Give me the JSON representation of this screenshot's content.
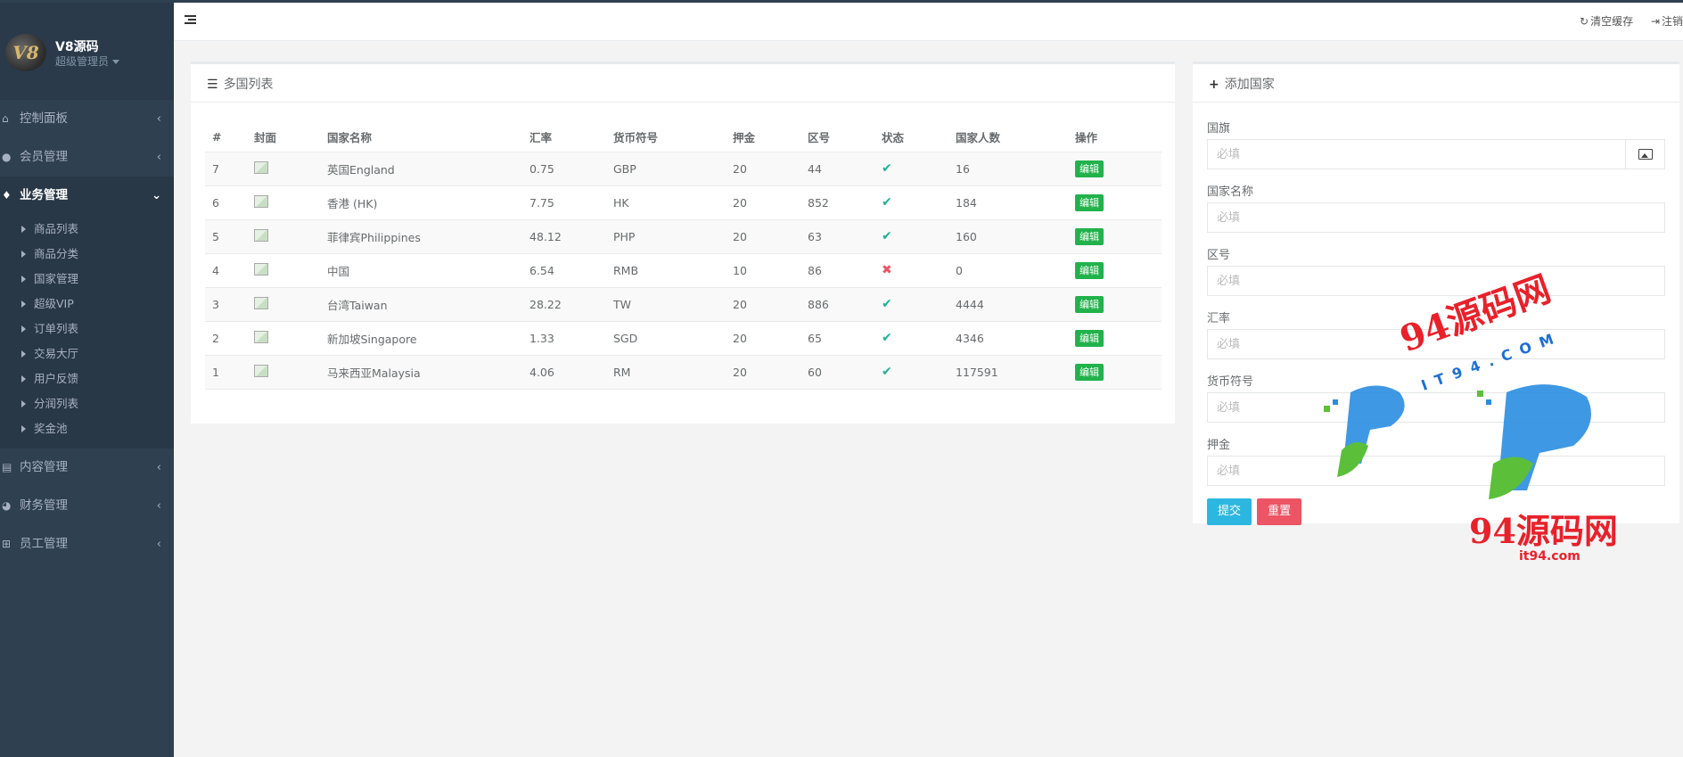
{
  "sidebar": {
    "logo": "V8",
    "name": "V8源码",
    "role": "超级管理员",
    "nav": [
      {
        "label": "控制面板"
      },
      {
        "label": "会员管理"
      },
      {
        "label": "业务管理"
      },
      {
        "label": "内容管理"
      },
      {
        "label": "财务管理"
      },
      {
        "label": "员工管理"
      }
    ],
    "submenu": [
      {
        "label": "商品列表"
      },
      {
        "label": "商品分类"
      },
      {
        "label": "国家管理"
      },
      {
        "label": "超级VIP"
      },
      {
        "label": "订单列表"
      },
      {
        "label": "交易大厅"
      },
      {
        "label": "用户反馈"
      },
      {
        "label": "分润列表"
      },
      {
        "label": "奖金池"
      }
    ]
  },
  "topbar": {
    "clear_cache": "清空缓存",
    "logout": "注销"
  },
  "list": {
    "title": "多国列表",
    "columns": [
      "#",
      "封面",
      "国家名称",
      "汇率",
      "货币符号",
      "押金",
      "区号",
      "状态",
      "国家人数",
      "操作"
    ],
    "edit_label": "编辑",
    "rows": [
      {
        "id": "7",
        "name": "英国England",
        "rate": "0.75",
        "currency": "GBP",
        "deposit": "20",
        "code": "44",
        "status": "ok",
        "people": "16"
      },
      {
        "id": "6",
        "name": "香港 (HK)",
        "rate": "7.75",
        "currency": "HK",
        "deposit": "20",
        "code": "852",
        "status": "ok",
        "people": "184"
      },
      {
        "id": "5",
        "name": "菲律宾Philippines",
        "rate": "48.12",
        "currency": "PHP",
        "deposit": "20",
        "code": "63",
        "status": "ok",
        "people": "160"
      },
      {
        "id": "4",
        "name": "中国",
        "rate": "6.54",
        "currency": "RMB",
        "deposit": "10",
        "code": "86",
        "status": "bad",
        "people": "0"
      },
      {
        "id": "3",
        "name": "台湾Taiwan",
        "rate": "28.22",
        "currency": "TW",
        "deposit": "20",
        "code": "886",
        "status": "ok",
        "people": "4444"
      },
      {
        "id": "2",
        "name": "新加坡Singapore",
        "rate": "1.33",
        "currency": "SGD",
        "deposit": "20",
        "code": "65",
        "status": "ok",
        "people": "4346"
      },
      {
        "id": "1",
        "name": "马来西亚Malaysia",
        "rate": "4.06",
        "currency": "RM",
        "deposit": "20",
        "code": "60",
        "status": "ok",
        "people": "117591"
      }
    ]
  },
  "form": {
    "title": "添加国家",
    "placeholder": "必填",
    "fields": [
      {
        "label": "国旗"
      },
      {
        "label": "国家名称"
      },
      {
        "label": "区号"
      },
      {
        "label": "汇率"
      },
      {
        "label": "货币符号"
      },
      {
        "label": "押金"
      }
    ],
    "submit": "提交",
    "reset": "重置"
  },
  "watermark": {
    "text1": "94源码网",
    "domain1": "IT94.COM",
    "text2": "94源码网",
    "domain2": "it94.com"
  },
  "colors": {
    "sidebar": "#2f4050",
    "ok": "#1ab394",
    "bad": "#ed5565",
    "edit": "#22b24c",
    "submit": "#2db7e0",
    "reset": "#ed5565"
  }
}
